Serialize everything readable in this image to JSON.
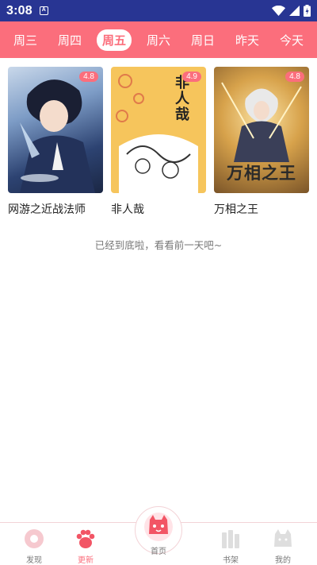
{
  "status_bar": {
    "time": "3:08",
    "notification_glyph": "A"
  },
  "day_tabs": [
    {
      "label": "周三"
    },
    {
      "label": "周四"
    },
    {
      "label": "周五",
      "active": true
    },
    {
      "label": "周六"
    },
    {
      "label": "周日"
    },
    {
      "label": "昨天"
    },
    {
      "label": "今天"
    }
  ],
  "comics": [
    {
      "title": "网游之近战法师",
      "rating": "4.8",
      "cover_colors": [
        "#3e5a8f",
        "#c9d8ea"
      ]
    },
    {
      "title": "非人哉",
      "rating": "4.9",
      "cover_colors": [
        "#f6c55c",
        "#ffffff"
      ],
      "cover_text": "非人哉"
    },
    {
      "title": "万相之王",
      "rating": "4.8",
      "cover_colors": [
        "#c9973a",
        "#6a4a23"
      ],
      "cover_text": "万相之王"
    }
  ],
  "end_message": "已经到底啦，看看前一天吧~",
  "bottom_nav": {
    "discover": "发现",
    "update": "更新",
    "home": "首页",
    "bookshelf": "书架",
    "mine": "我的"
  },
  "colors": {
    "accent": "#fb6e7c",
    "status_bar": "#283593"
  }
}
